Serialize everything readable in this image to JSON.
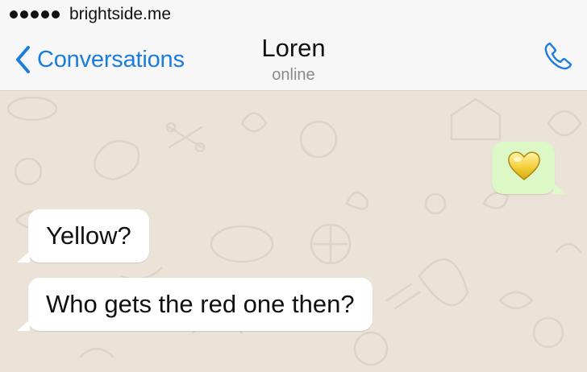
{
  "status_bar": {
    "carrier": "brightside.me"
  },
  "nav": {
    "back_label": "Conversations",
    "contact_name": "Loren",
    "contact_status": "online"
  },
  "messages": [
    {
      "direction": "outgoing",
      "emoji": "yellow-heart"
    },
    {
      "direction": "incoming",
      "text": "Yellow?"
    },
    {
      "direction": "incoming",
      "text": "Who gets the red one then?"
    }
  ],
  "colors": {
    "accent": "#1b7ce0",
    "outgoing_bubble": "#dcf8c6",
    "incoming_bubble": "#ffffff",
    "chat_background": "#ebe3d8"
  }
}
